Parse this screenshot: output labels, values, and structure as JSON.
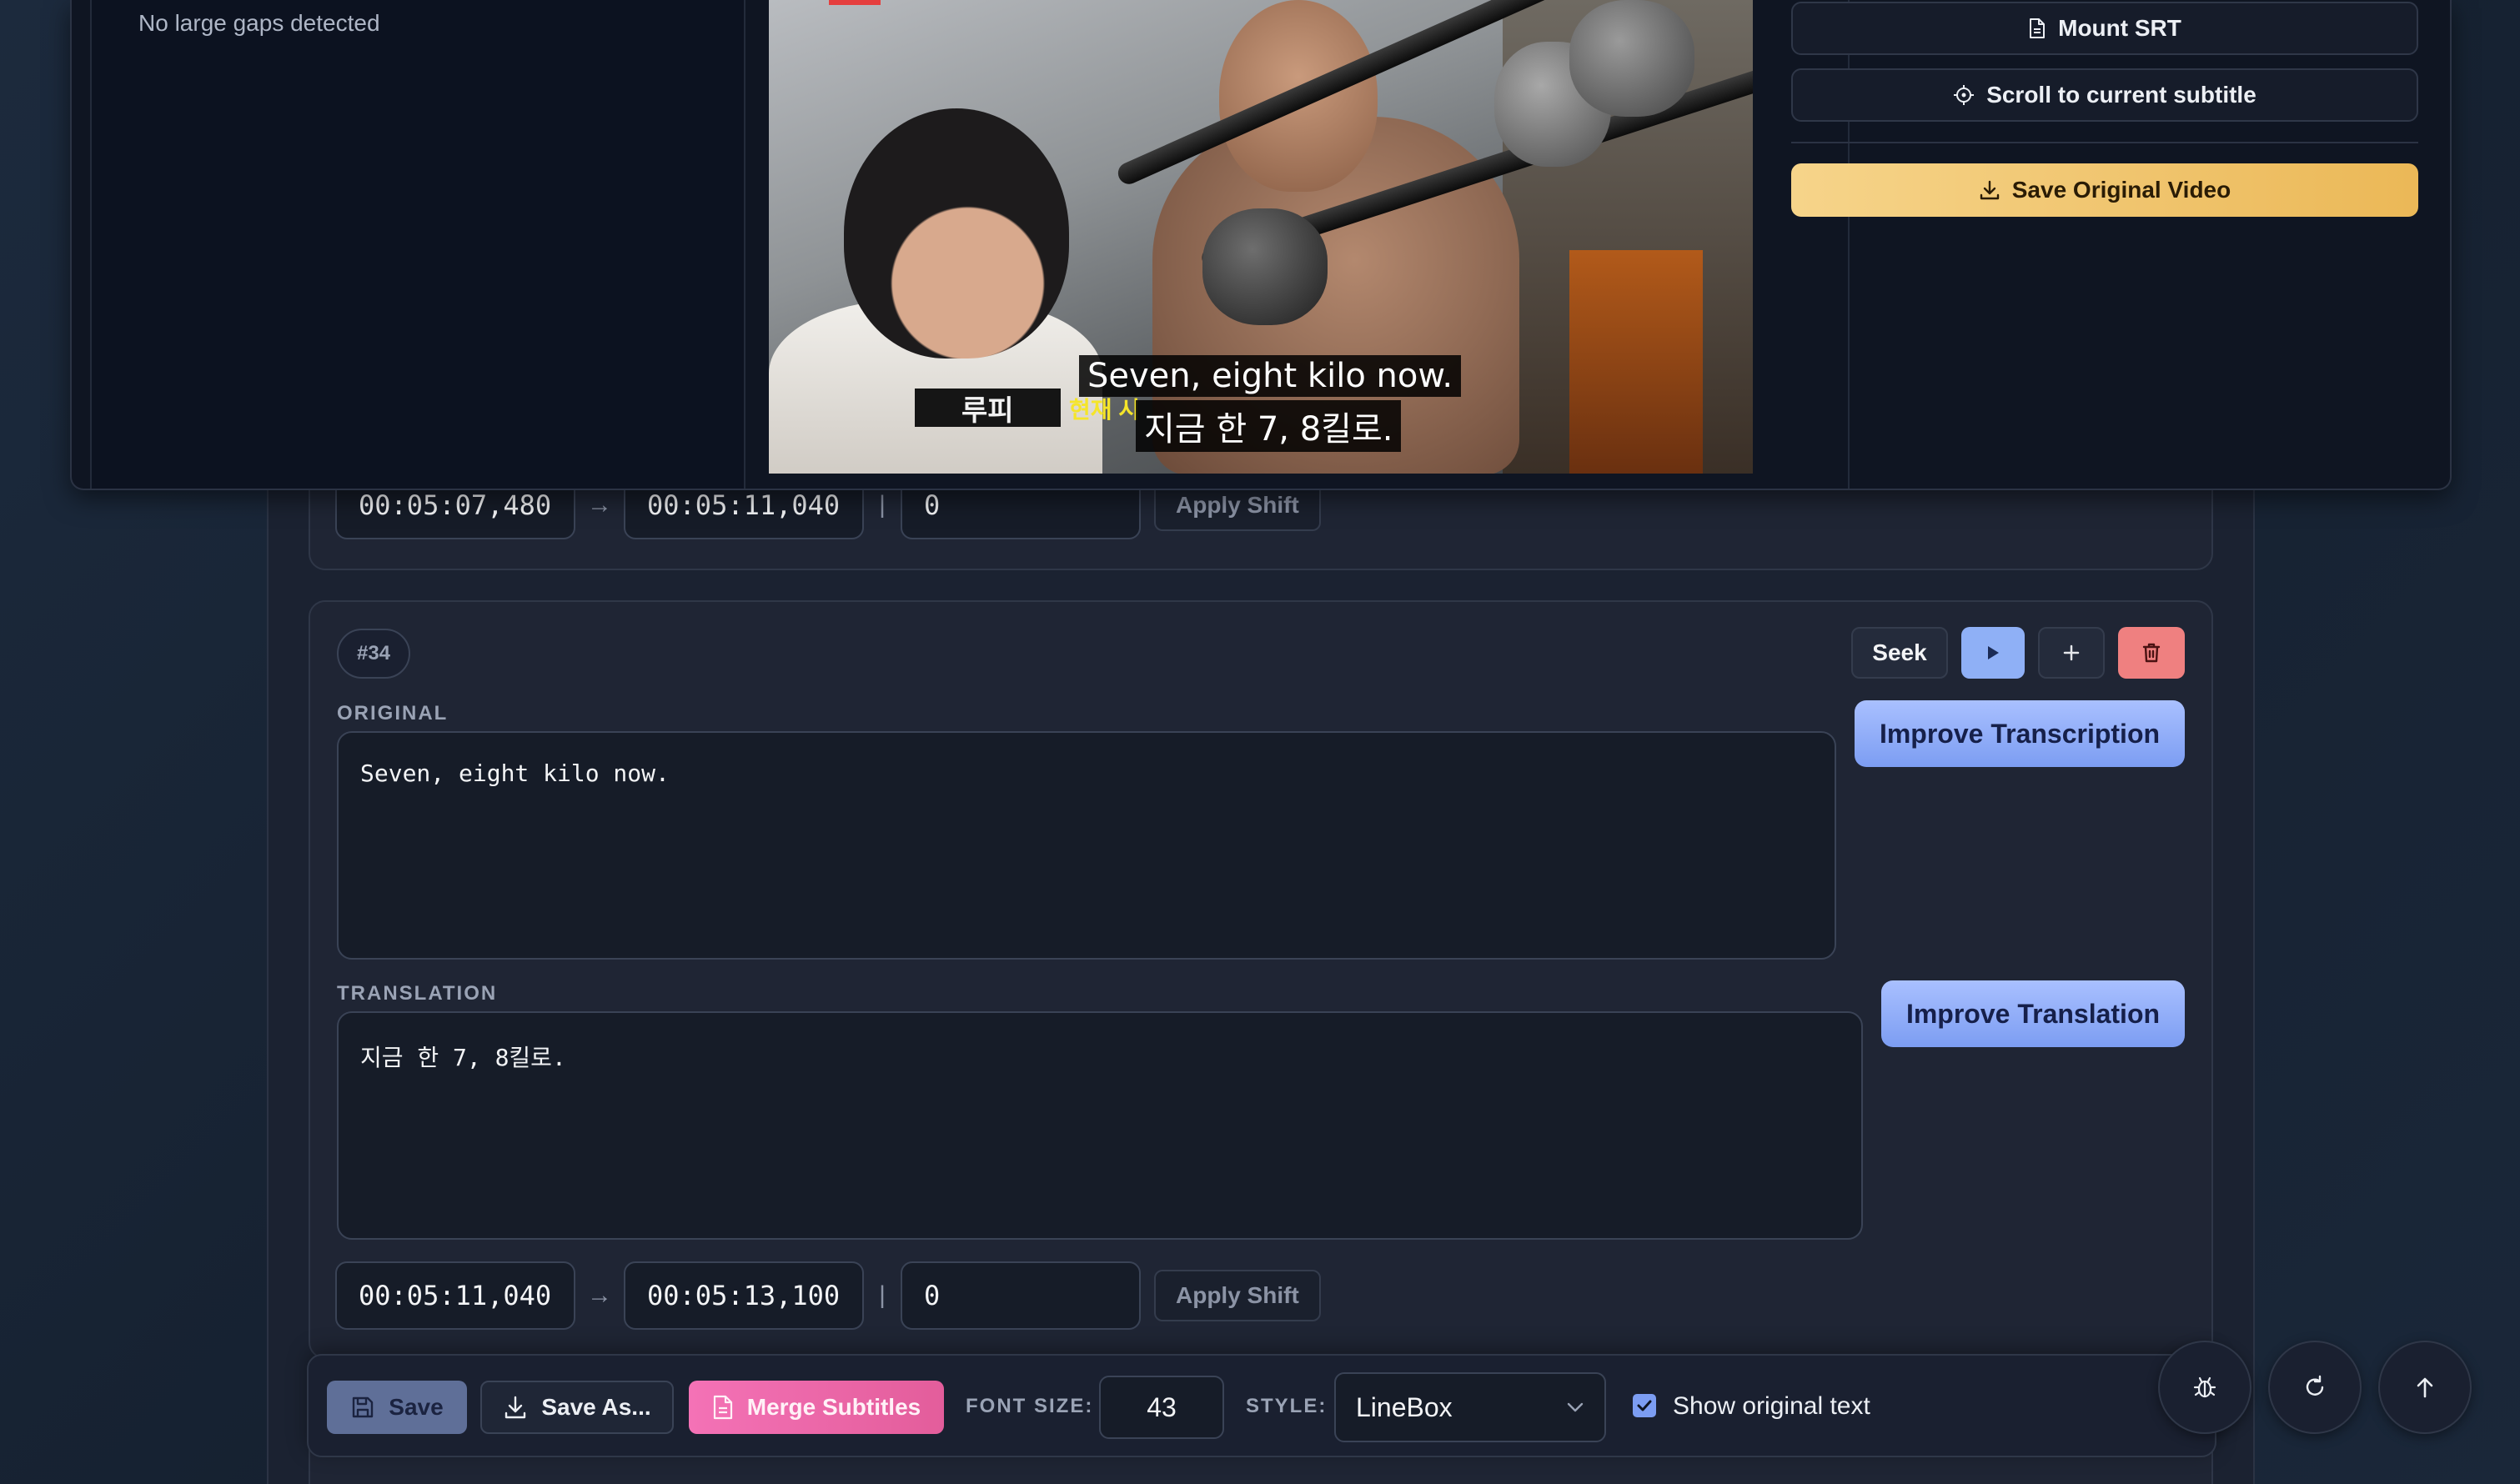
{
  "subtitles": [
    {
      "start": "00:05:07,480",
      "end": "00:05:11,040",
      "shift": "0",
      "apply_shift_label": "Apply Shift"
    },
    {
      "index": "#34",
      "original_label": "ORIGINAL",
      "original_text": "Seven, eight kilo now.",
      "translation_label": "TRANSLATION",
      "translation_text": "지금 한 7, 8킬로.",
      "start": "00:05:11,040",
      "end": "00:05:13,100",
      "shift": "0",
      "apply_shift_label": "Apply Shift",
      "seek_label": "Seek",
      "improve_transcription_label": "Improve Transcription",
      "improve_translation_label": "Improve Translation"
    }
  ],
  "time_arrow": "→",
  "time_bar": "|",
  "gap_panel": {
    "status": "No large gaps detected"
  },
  "video": {
    "name_chip": "루피",
    "yellow_caption": "현재 시",
    "subtitle_original": "Seven, eight kilo now.",
    "subtitle_translation": "지금 한 7, 8킬로."
  },
  "side_actions": {
    "mount_srt": "Mount SRT",
    "scroll_to_current": "Scroll to current subtitle",
    "save_original_video": "Save Original Video"
  },
  "toolbar": {
    "save": "Save",
    "save_as": "Save As...",
    "merge_subtitles": "Merge Subtitles",
    "font_size_label": "FONT SIZE:",
    "font_size_value": "43",
    "style_label": "STYLE:",
    "style_value": "LineBox",
    "show_original_label": "Show original text",
    "show_original_checked": true
  },
  "colors": {
    "accent_blue": "#7c9df2",
    "accent_pink": "#f472b6",
    "accent_gold": "#ebb857",
    "danger": "#ef8080"
  }
}
